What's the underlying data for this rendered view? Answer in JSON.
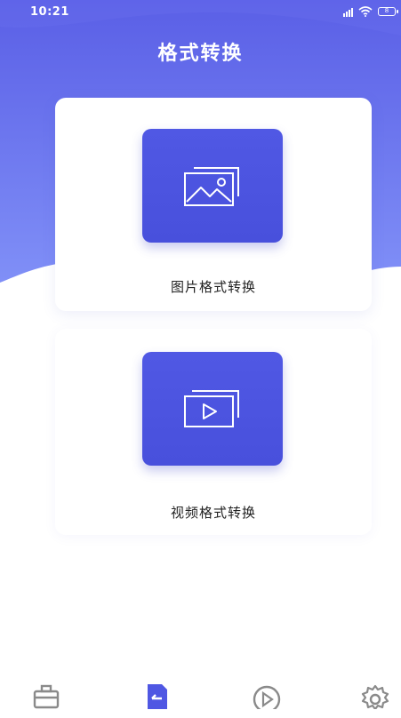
{
  "status_bar": {
    "time": "10:21",
    "battery_text": "8",
    "signal_icon": "signal-icon",
    "wifi_icon": "wifi-icon",
    "battery_icon": "battery-icon"
  },
  "header": {
    "title": "格式转换"
  },
  "cards": [
    {
      "label": "图片格式转换",
      "icon": "image-icon"
    },
    {
      "label": "视频格式转换",
      "icon": "video-icon"
    }
  ],
  "bottom_nav": {
    "items": [
      {
        "icon": "toolbox-icon",
        "active": false
      },
      {
        "icon": "convert-icon",
        "active": true
      },
      {
        "icon": "play-icon",
        "active": false
      },
      {
        "icon": "gear-icon",
        "active": false
      }
    ]
  },
  "colors": {
    "accent": "#4f57e3",
    "hero_top": "#5a5fe6",
    "hero_bottom": "#7e8ef6",
    "inactive_icon": "#8a8a8a"
  }
}
